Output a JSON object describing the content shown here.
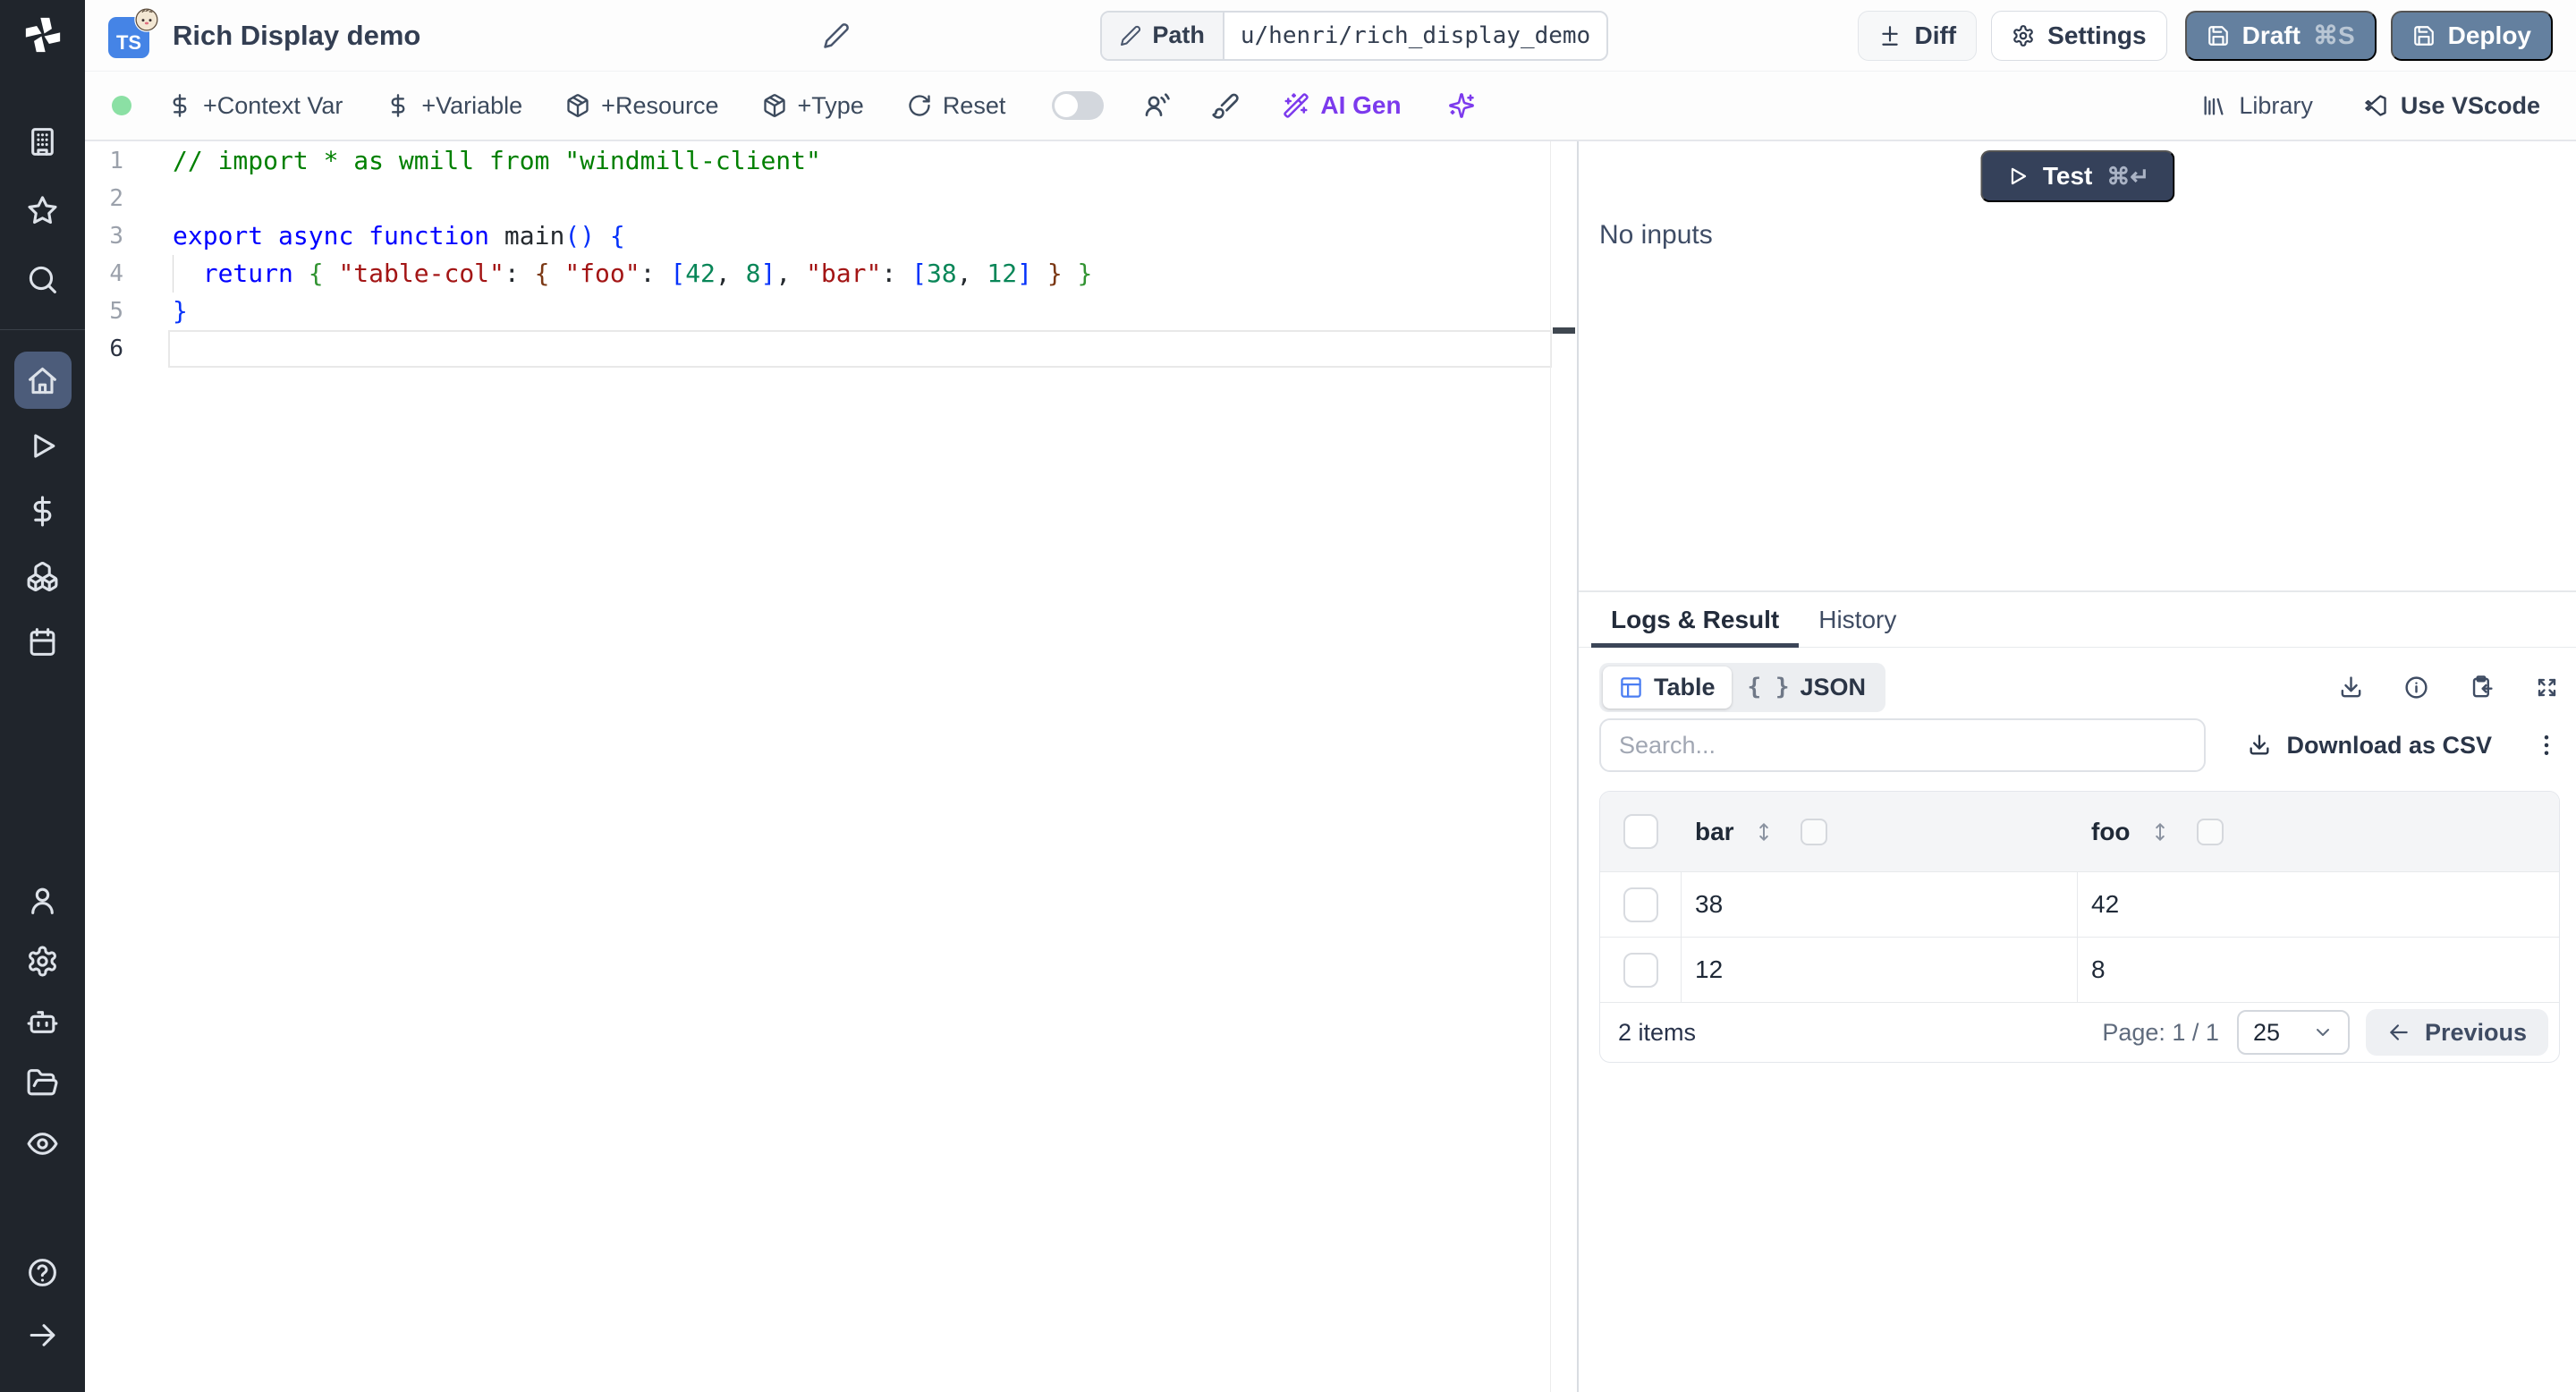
{
  "header": {
    "language_badge": "TS",
    "title": "Rich Display demo",
    "path_label": "Path",
    "path_value": "u/henri/rich_display_demo",
    "diff_label": "Diff",
    "settings_label": "Settings",
    "draft_label": "Draft",
    "draft_shortcut": "⌘S",
    "deploy_label": "Deploy"
  },
  "sidebar": {
    "top_items": [
      {
        "name": "workspace",
        "icon": "building"
      },
      {
        "name": "favorites",
        "icon": "star"
      },
      {
        "name": "search",
        "icon": "search"
      }
    ],
    "main_items": [
      {
        "name": "home",
        "icon": "home",
        "active": true
      },
      {
        "name": "runs",
        "icon": "play"
      },
      {
        "name": "variables",
        "icon": "dollar"
      },
      {
        "name": "resources",
        "icon": "boxes"
      },
      {
        "name": "schedules",
        "icon": "calendar"
      }
    ],
    "admin_items": [
      {
        "name": "users",
        "icon": "user"
      },
      {
        "name": "settings",
        "icon": "gear"
      },
      {
        "name": "workers",
        "icon": "bot"
      },
      {
        "name": "folders",
        "icon": "folder"
      },
      {
        "name": "audit-logs",
        "icon": "eye"
      }
    ],
    "bottom_items": [
      {
        "name": "help",
        "icon": "help"
      },
      {
        "name": "expand",
        "icon": "arrow-right"
      }
    ]
  },
  "toolbar": {
    "actions": [
      {
        "label": "+Context Var",
        "icon": "dollar"
      },
      {
        "label": "+Variable",
        "icon": "dollar"
      },
      {
        "label": "+Resource",
        "icon": "package"
      },
      {
        "label": "+Type",
        "icon": "package"
      },
      {
        "label": "Reset",
        "icon": "refresh"
      }
    ],
    "ai_gen_label": "AI Gen",
    "library_label": "Library",
    "vscode_label": "Use VScode"
  },
  "editor": {
    "active_line": "6",
    "lines": [
      {
        "num": "1",
        "tokens": [
          [
            "// import * as wmill from \"windmill-client\"",
            "c"
          ]
        ]
      },
      {
        "num": "2",
        "tokens": []
      },
      {
        "num": "3",
        "tokens": [
          [
            "export",
            "k"
          ],
          [
            " ",
            "p"
          ],
          [
            "async",
            "k"
          ],
          [
            " ",
            "p"
          ],
          [
            "function",
            "k"
          ],
          [
            " ",
            "p"
          ],
          [
            "main",
            "id"
          ],
          [
            "(",
            "b1"
          ],
          [
            ")",
            "b1"
          ],
          [
            " ",
            "p"
          ],
          [
            "{",
            "b1"
          ]
        ]
      },
      {
        "num": "4",
        "tokens": [
          [
            "  ",
            "p"
          ],
          [
            "return",
            "k"
          ],
          [
            " ",
            "p"
          ],
          [
            "{",
            "b2"
          ],
          [
            " ",
            "p"
          ],
          [
            "\"table-col\"",
            "s"
          ],
          [
            ":",
            "p"
          ],
          [
            " ",
            "p"
          ],
          [
            "{",
            "b3"
          ],
          [
            " ",
            "p"
          ],
          [
            "\"foo\"",
            "s"
          ],
          [
            ":",
            "p"
          ],
          [
            " ",
            "p"
          ],
          [
            "[",
            "b1"
          ],
          [
            "42",
            "n"
          ],
          [
            ",",
            "p"
          ],
          [
            " ",
            "p"
          ],
          [
            "8",
            "n"
          ],
          [
            "]",
            "b1"
          ],
          [
            ",",
            "p"
          ],
          [
            " ",
            "p"
          ],
          [
            "\"bar\"",
            "s"
          ],
          [
            ":",
            "p"
          ],
          [
            " ",
            "p"
          ],
          [
            "[",
            "b1"
          ],
          [
            "38",
            "n"
          ],
          [
            ",",
            "p"
          ],
          [
            " ",
            "p"
          ],
          [
            "12",
            "n"
          ],
          [
            "]",
            "b1"
          ],
          [
            " ",
            "p"
          ],
          [
            "}",
            "b3"
          ],
          [
            " ",
            "p"
          ],
          [
            "}",
            "b2"
          ]
        ]
      },
      {
        "num": "5",
        "tokens": [
          [
            "}",
            "b1"
          ]
        ]
      },
      {
        "num": "6",
        "tokens": []
      }
    ]
  },
  "run_panel": {
    "test_label": "Test",
    "test_shortcut": "⌘↵",
    "no_inputs": "No inputs",
    "tab_logs": "Logs & Result",
    "tab_history": "History",
    "view_table": "Table",
    "view_json": "JSON",
    "braces_glyph": "{ }",
    "search_placeholder": "Search...",
    "download_csv": "Download as CSV",
    "table": {
      "columns": [
        "bar",
        "foo"
      ],
      "rows": [
        [
          "38",
          "42"
        ],
        [
          "12",
          "8"
        ]
      ]
    },
    "footer": {
      "items_count": "2 items",
      "page_label": "Page: 1 / 1",
      "page_size": "25",
      "previous_label": "Previous"
    }
  },
  "colors": {
    "status_green": "#8be0a4",
    "accent_blue": "#4a7df2",
    "slate_button": "#64809f",
    "dark_button": "#35415a",
    "ai_purple": "#7c3aed",
    "sidebar_bg": "#20252c",
    "sidebar_active": "#4c5c7a"
  }
}
